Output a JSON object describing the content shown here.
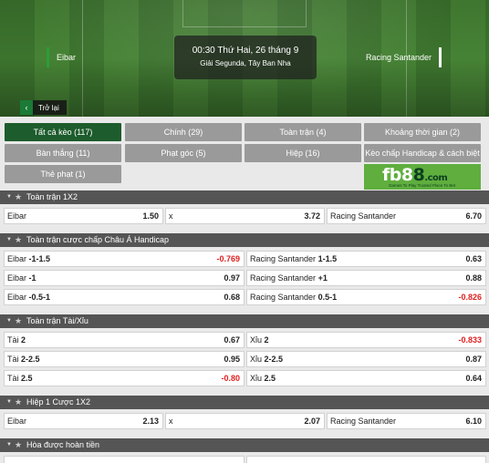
{
  "match": {
    "home_team": "Eibar",
    "away_team": "Racing Santander",
    "datetime": "00:30 Thứ Hai, 26 tháng 9",
    "league": "Giải Segunda, Tây Ban Nha",
    "back_label": "Trở lại"
  },
  "filters": [
    {
      "label": "Tất cả kèo (117)",
      "active": true
    },
    {
      "label": "Chính (29)",
      "active": false
    },
    {
      "label": "Toàn trận (4)",
      "active": false
    },
    {
      "label": "Khoảng thời gian (2)",
      "active": false
    },
    {
      "label": "Bàn thắng (11)",
      "active": false
    },
    {
      "label": "Phạt góc (5)",
      "active": false
    },
    {
      "label": "Hiệp (16)",
      "active": false
    },
    {
      "label": "Kèo chấp Handicap & cách biệt (3)",
      "active": false
    },
    {
      "label": "Thẻ phạt (1)",
      "active": false
    }
  ],
  "ad": {
    "brand_prefix": "fb8",
    "brand_suffix": "8",
    "brand_tld": ".com",
    "tagline": "Games To Play  Trusted Place To Bet"
  },
  "sections": [
    {
      "title": "Toàn trận 1X2",
      "rows": [
        [
          {
            "name": "Eibar",
            "handicap": "",
            "odds": "1.50",
            "negative": false
          },
          {
            "name": "x",
            "handicap": "",
            "odds": "3.72",
            "negative": false
          },
          {
            "name": "Racing Santander",
            "handicap": "",
            "odds": "6.70",
            "negative": false
          }
        ]
      ]
    },
    {
      "title": "Toàn trận cược chấp Châu Á Handicap",
      "rows": [
        [
          {
            "name": "Eibar",
            "handicap": "-1-1.5",
            "odds": "-0.769",
            "negative": true
          },
          {
            "name": "Racing Santander",
            "handicap": "1-1.5",
            "odds": "0.63",
            "negative": false
          }
        ],
        [
          {
            "name": "Eibar",
            "handicap": "-1",
            "odds": "0.97",
            "negative": false
          },
          {
            "name": "Racing Santander",
            "handicap": "+1",
            "odds": "0.88",
            "negative": false
          }
        ],
        [
          {
            "name": "Eibar",
            "handicap": "-0.5-1",
            "odds": "0.68",
            "negative": false
          },
          {
            "name": "Racing Santander",
            "handicap": "0.5-1",
            "odds": "-0.826",
            "negative": true
          }
        ]
      ]
    },
    {
      "title": "Toàn trận Tài/Xỉu",
      "rows": [
        [
          {
            "name": "Tài",
            "handicap": "2",
            "odds": "0.67",
            "negative": false
          },
          {
            "name": "Xỉu",
            "handicap": "2",
            "odds": "-0.833",
            "negative": true
          }
        ],
        [
          {
            "name": "Tài",
            "handicap": "2-2.5",
            "odds": "0.95",
            "negative": false
          },
          {
            "name": "Xỉu",
            "handicap": "2-2.5",
            "odds": "0.87",
            "negative": false
          }
        ],
        [
          {
            "name": "Tài",
            "handicap": "2.5",
            "odds": "-0.80",
            "negative": true
          },
          {
            "name": "Xỉu",
            "handicap": "2.5",
            "odds": "0.64",
            "negative": false
          }
        ]
      ]
    },
    {
      "title": "Hiệp 1 Cược 1X2",
      "rows": [
        [
          {
            "name": "Eibar",
            "handicap": "",
            "odds": "2.13",
            "negative": false
          },
          {
            "name": "x",
            "handicap": "",
            "odds": "2.07",
            "negative": false
          },
          {
            "name": "Racing Santander",
            "handicap": "",
            "odds": "6.10",
            "negative": false
          }
        ]
      ]
    },
    {
      "title": "Hòa được hoàn tiền",
      "rows": []
    }
  ]
}
